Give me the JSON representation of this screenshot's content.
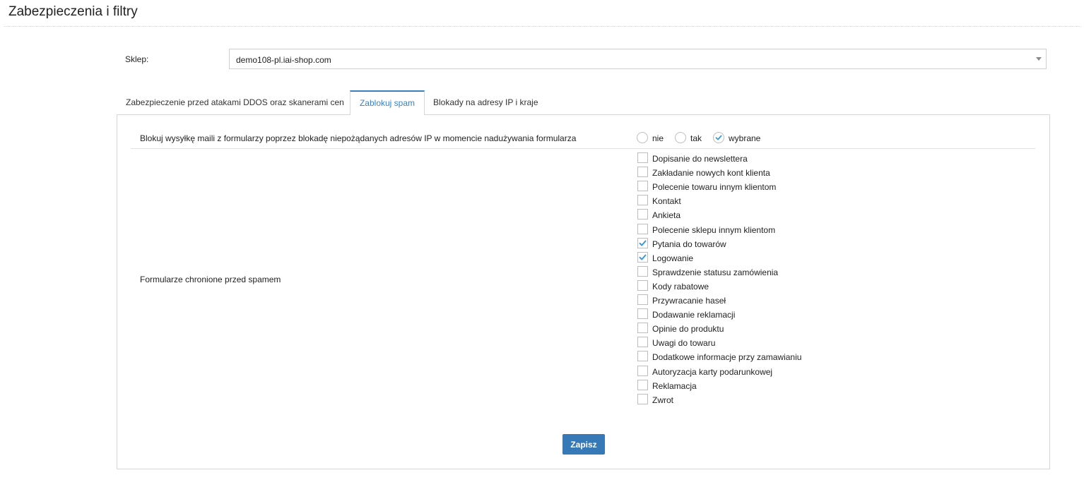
{
  "page": {
    "title": "Zabezpieczenia i filtry"
  },
  "shop": {
    "label": "Sklep:",
    "selected": "demo108-pl.iai-shop.com"
  },
  "tabs": [
    {
      "label": "Zabezpieczenie przed atakami DDOS oraz skanerami cen",
      "active": false
    },
    {
      "label": "Zablokuj spam",
      "active": true
    },
    {
      "label": "Blokady na adresy IP i kraje",
      "active": false
    }
  ],
  "block_setting": {
    "label": "Blokuj wysyłkę maili z formularzy poprzez blokadę niepożądanych adresów IP w momencie nadużywania formularza",
    "options": [
      {
        "label": "nie",
        "selected": false
      },
      {
        "label": "tak",
        "selected": false
      },
      {
        "label": "wybrane",
        "selected": true
      }
    ]
  },
  "forms": {
    "label": "Formularze chronione przed spamem",
    "items": [
      {
        "label": "Dopisanie do newslettera",
        "checked": false
      },
      {
        "label": "Zakładanie nowych kont klienta",
        "checked": false
      },
      {
        "label": "Polecenie towaru innym klientom",
        "checked": false
      },
      {
        "label": "Kontakt",
        "checked": false
      },
      {
        "label": "Ankieta",
        "checked": false
      },
      {
        "label": "Polecenie sklepu innym klientom",
        "checked": false
      },
      {
        "label": "Pytania do towarów",
        "checked": true
      },
      {
        "label": "Logowanie",
        "checked": true
      },
      {
        "label": "Sprawdzenie statusu zamówienia",
        "checked": false
      },
      {
        "label": "Kody rabatowe",
        "checked": false
      },
      {
        "label": "Przywracanie haseł",
        "checked": false
      },
      {
        "label": "Dodawanie reklamacji",
        "checked": false
      },
      {
        "label": "Opinie do produktu",
        "checked": false
      },
      {
        "label": "Uwagi do towaru",
        "checked": false
      },
      {
        "label": "Dodatkowe informacje przy zamawianiu",
        "checked": false
      },
      {
        "label": "Autoryzacja karty podarunkowej",
        "checked": false
      },
      {
        "label": "Reklamacja",
        "checked": false
      },
      {
        "label": "Zwrot",
        "checked": false
      }
    ]
  },
  "actions": {
    "save_label": "Zapisz"
  },
  "colors": {
    "accent": "#3a80bf",
    "button": "#3778b6",
    "check": "#3a9bd9"
  }
}
